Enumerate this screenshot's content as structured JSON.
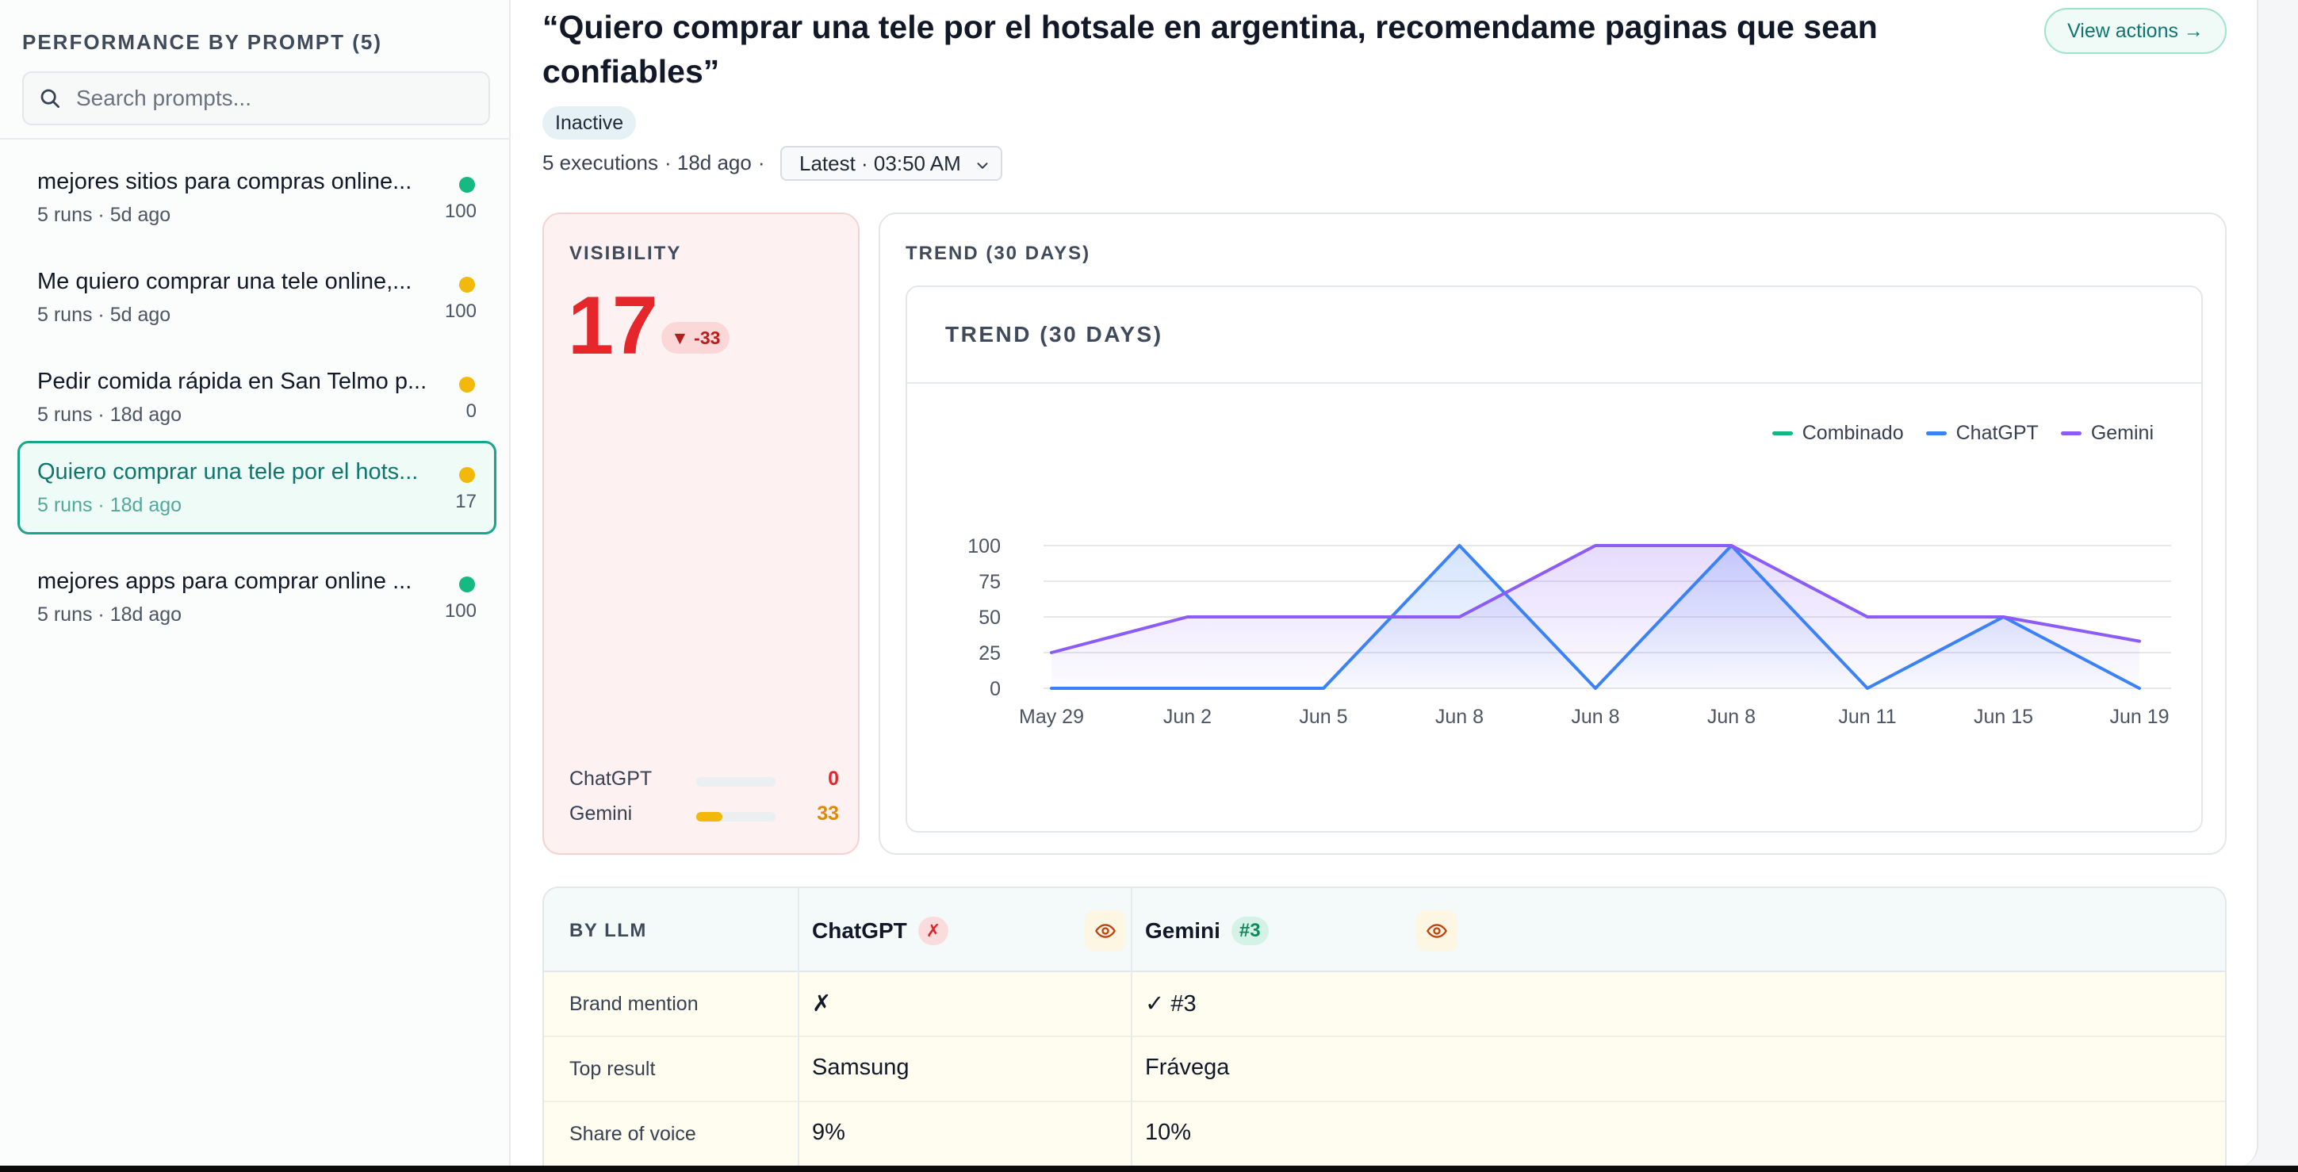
{
  "sidebar": {
    "title": "PERFORMANCE BY PROMPT (5)",
    "search_placeholder": "Search prompts...",
    "items": [
      {
        "title": "mejores sitios para compras online...",
        "meta": "5 runs · 5d ago",
        "score": "100",
        "dot_color": "#16b981",
        "active": false
      },
      {
        "title": "Me quiero comprar una tele online,...",
        "meta": "5 runs · 5d ago",
        "score": "100",
        "dot_color": "#f2b90a",
        "active": false
      },
      {
        "title": "Pedir comida rápida en San Telmo p...",
        "meta": "5 runs · 18d ago",
        "score": "0",
        "dot_color": "#f2b90a",
        "active": false
      },
      {
        "title": "Quiero comprar una tele por el hots...",
        "meta": "5 runs · 18d ago",
        "score": "17",
        "dot_color": "#f2b90a",
        "active": true
      },
      {
        "title": "mejores apps para comprar online ...",
        "meta": "5 runs · 18d ago",
        "score": "100",
        "dot_color": "#16b981",
        "active": false
      }
    ]
  },
  "header": {
    "title": "“Quiero comprar una tele por el hotsale en argentina, recomendame paginas que sean confiables”",
    "view_actions": "View actions →",
    "status": "Inactive",
    "executions": "5 executions",
    "age": "· 18d ago",
    "dot_sep": "·",
    "latest": "Latest · 03:50 AM"
  },
  "visibility": {
    "label": "VISIBILITY",
    "value": "17",
    "delta": "▼ -33",
    "rows": [
      {
        "llm": "ChatGPT",
        "value": "0",
        "fraction": 0.0,
        "color": "#e5262b"
      },
      {
        "llm": "Gemini",
        "value": "33",
        "fraction": 0.33,
        "color": "#e08a00"
      }
    ]
  },
  "trend": {
    "outer_label": "TREND (30 DAYS)",
    "inner_title": "TREND (30 DAYS)"
  },
  "chart_data": {
    "type": "line",
    "categories": [
      "May 29",
      "Jun 2",
      "Jun 5",
      "Jun 8",
      "Jun 8",
      "Jun 8",
      "Jun 11",
      "Jun 15",
      "Jun 19"
    ],
    "ylim": [
      0,
      100
    ],
    "yticks": [
      0,
      25,
      50,
      75,
      100
    ],
    "grid": true,
    "legend_position": "top-right",
    "series": [
      {
        "name": "Combinado",
        "color": "#10b981",
        "values": []
      },
      {
        "name": "ChatGPT",
        "color": "#3b82f6",
        "values": [
          0,
          0,
          0,
          100,
          0,
          100,
          0,
          50,
          0
        ]
      },
      {
        "name": "Gemini",
        "color": "#8b5cf6",
        "values": [
          25,
          50,
          50,
          50,
          100,
          100,
          50,
          50,
          33
        ]
      }
    ]
  },
  "by_llm": {
    "label": "BY LLM",
    "columns": [
      {
        "name": "ChatGPT",
        "badge": "✗",
        "badge_type": "x"
      },
      {
        "name": "Gemini",
        "badge": "#3",
        "badge_type": "rank"
      }
    ],
    "rows": [
      {
        "label": "Brand mention",
        "values": [
          "✗",
          "✓ #3"
        ]
      },
      {
        "label": "Top result",
        "values": [
          "Samsung",
          "Frávega"
        ]
      },
      {
        "label": "Share of voice",
        "values": [
          "9%",
          "10%"
        ]
      }
    ]
  }
}
